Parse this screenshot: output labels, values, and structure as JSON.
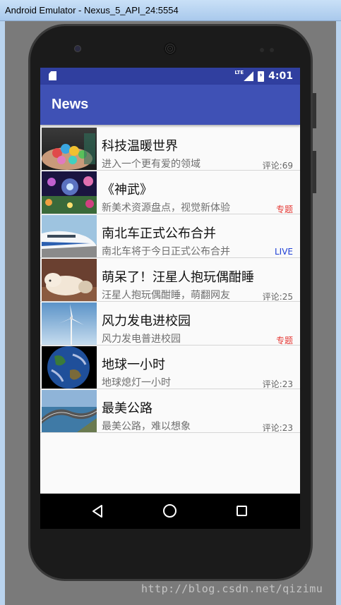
{
  "window": {
    "title": "Android Emulator - Nexus_5_API_24:5554"
  },
  "statusbar": {
    "network": "LTE",
    "time": "4:01"
  },
  "toolbar": {
    "title": "News"
  },
  "news": [
    {
      "title": "科技温暖世界",
      "subtitle": "进入一个更有爱的领域",
      "tag": "评论:69",
      "tag_color": "#666666"
    },
    {
      "title": "《神武》",
      "subtitle": "新美术资源盘点，视觉新体验",
      "tag": "专题",
      "tag_color": "#e53935"
    },
    {
      "title": "南北车正式公布合并",
      "subtitle": "南北车将于今日正式公布合并",
      "tag": "LIVE",
      "tag_color": "#1e3fd6"
    },
    {
      "title": "萌呆了！汪星人抱玩偶酣睡",
      "subtitle": "汪星人抱玩偶酣睡，萌翻网友",
      "tag": "评论:25",
      "tag_color": "#666666"
    },
    {
      "title": "风力发电进校园",
      "subtitle": "风力发电普进校园",
      "tag": "专题",
      "tag_color": "#e53935"
    },
    {
      "title": "地球一小时",
      "subtitle": "地球熄灯一小时",
      "tag": "评论:23",
      "tag_color": "#666666"
    },
    {
      "title": "最美公路",
      "subtitle": "最美公路，难以想象",
      "tag": "评论:23",
      "tag_color": "#666666"
    }
  ],
  "thumbnails": [
    "hands-globe-photo",
    "fantasy-game-art",
    "bullet-train-photo",
    "sleeping-dog-photo",
    "wind-turbine-photo",
    "earth-photo",
    "coastal-road-photo"
  ],
  "navbar": {
    "icons": [
      "back-icon",
      "home-icon",
      "recent-apps-icon"
    ]
  },
  "watermark": "http://blog.csdn.net/qizimu"
}
